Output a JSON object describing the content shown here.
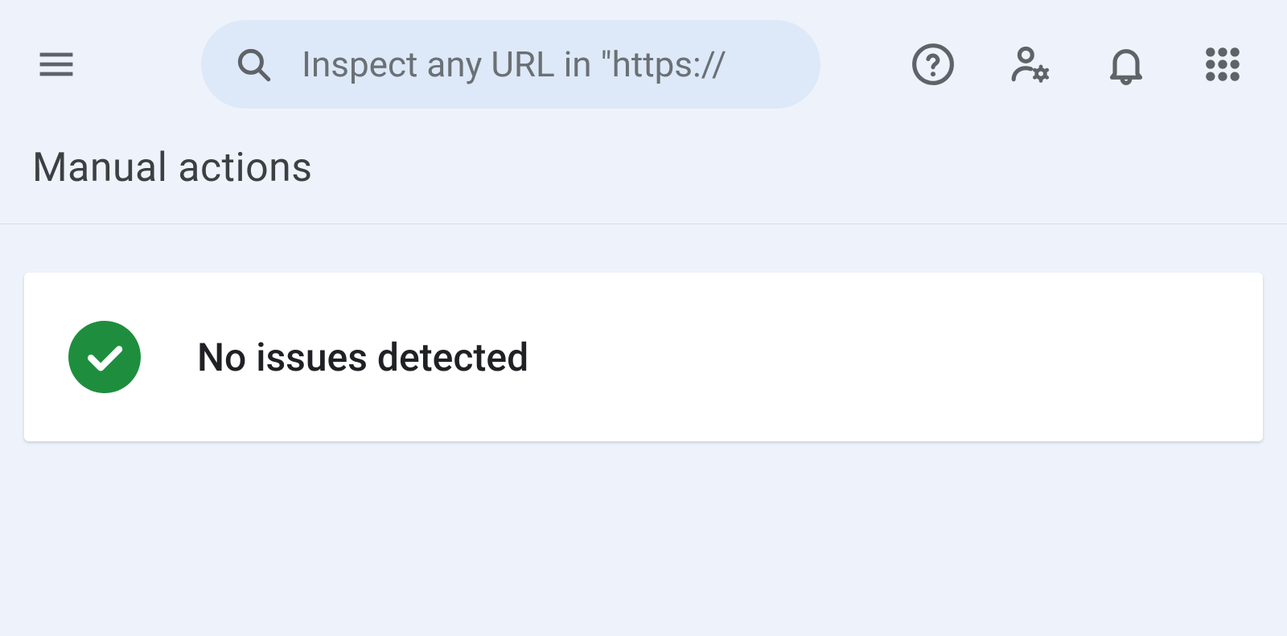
{
  "header": {
    "search_placeholder": "Inspect any URL in \"https://"
  },
  "page": {
    "title": "Manual actions"
  },
  "status": {
    "message": "No issues detected"
  },
  "colors": {
    "background": "#eef3fb",
    "search_background": "#dde9f8",
    "icon": "#5f6368",
    "success": "#1e8e3e",
    "text_primary": "#202124",
    "text_secondary": "#3c4043"
  }
}
